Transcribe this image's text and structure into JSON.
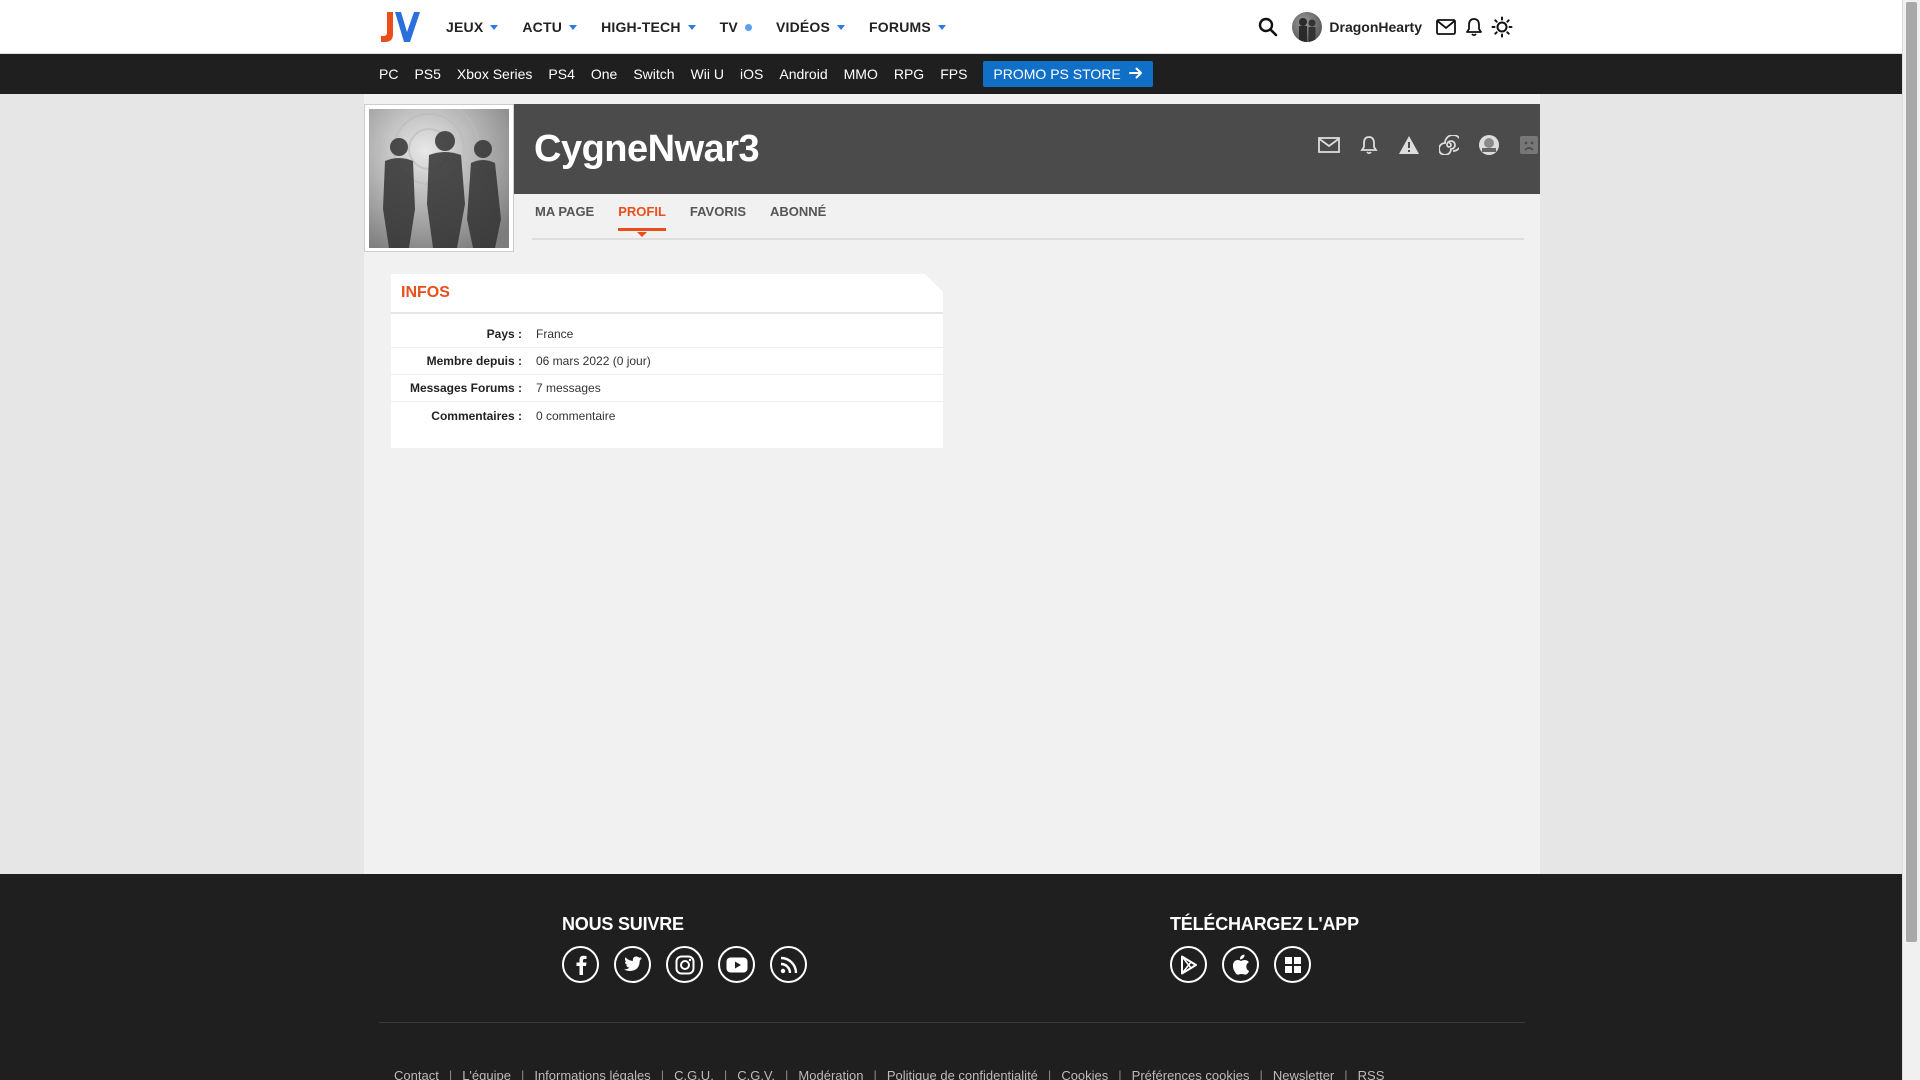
{
  "topnav": {
    "logo_text": "JV",
    "items": [
      {
        "label": "JEUX",
        "marker": "caret"
      },
      {
        "label": "ACTU",
        "marker": "caret"
      },
      {
        "label": "HIGH-TECH",
        "marker": "caret"
      },
      {
        "label": "TV",
        "marker": "dot"
      },
      {
        "label": "VIDÉOS",
        "marker": "caret"
      },
      {
        "label": "FORUMS",
        "marker": "caret"
      }
    ],
    "username": "DragonHearty",
    "icons": [
      "search-icon",
      "mail-icon",
      "bell-icon",
      "sun-icon"
    ]
  },
  "subnav": {
    "items": [
      "PC",
      "PS5",
      "Xbox Series",
      "PS4",
      "One",
      "Switch",
      "Wii U",
      "iOS",
      "Android",
      "MMO",
      "RPG",
      "FPS"
    ],
    "promo_label": "PROMO PS STORE"
  },
  "profile": {
    "username": "CygneNwar3",
    "banner_icons": [
      "mail-icon",
      "bell-icon",
      "warning-icon",
      "spiral-icon",
      "badge-icon",
      "sad-face-icon"
    ],
    "tabs": [
      {
        "label": "MA PAGE",
        "active": false
      },
      {
        "label": "PROFIL",
        "active": true
      },
      {
        "label": "FAVORIS",
        "active": false
      },
      {
        "label": "ABONNÉ",
        "active": false
      }
    ]
  },
  "infos": {
    "title": "INFOS",
    "rows": [
      {
        "label": "Pays :",
        "value": "France"
      },
      {
        "label": "Membre depuis :",
        "value": "06 mars 2022 (0 jour)"
      },
      {
        "label": "Messages Forums :",
        "value": "7 messages"
      },
      {
        "label": "Commentaires :",
        "value": "0 commentaire"
      }
    ]
  },
  "footer": {
    "follow_title": "NOUS SUIVRE",
    "app_title": "TÉLÉCHARGEZ L'APP",
    "social_icons": [
      "facebook-icon",
      "twitter-icon",
      "instagram-icon",
      "youtube-icon",
      "rss-icon"
    ],
    "app_icons": [
      "google-play-icon",
      "apple-icon",
      "windows-icon"
    ],
    "links": [
      "Contact",
      "L'équipe",
      "Informations légales",
      "C.G.U.",
      "C.G.V.",
      "Modération",
      "Politique de confidentialité",
      "Cookies",
      "Préférences cookies",
      "Newsletter",
      "RSS"
    ]
  },
  "colors": {
    "accent": "#e94e1b",
    "brand_blue": "#2a7be4",
    "promo": "#1070c8",
    "banner": "#4b4b4b",
    "footer": "#1f1f1f"
  }
}
